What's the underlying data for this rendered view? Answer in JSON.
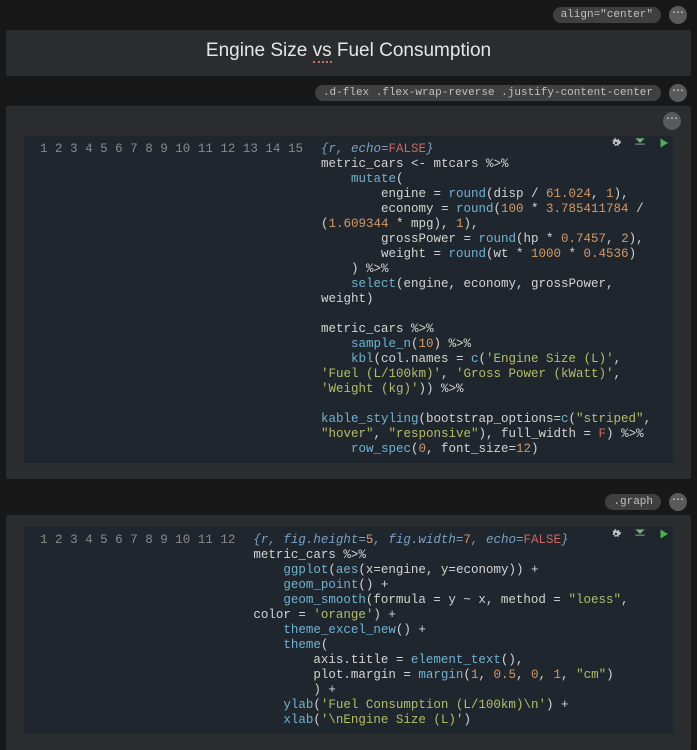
{
  "header": {
    "tag": "align=\"center\"",
    "title_pre": "Engine Size ",
    "title_vs": "vs",
    "title_post": " Fuel Consumption"
  },
  "block1": {
    "tag": ".d-flex .flex-wrap-reverse .justify-content-center",
    "gutter": [
      "1",
      "2",
      "3",
      "4",
      "5",
      "6",
      "7",
      "8",
      "9",
      "10",
      "11",
      "12",
      "13",
      "",
      "14",
      "",
      "15"
    ],
    "lines": {
      "l1_a": "{r, echo=",
      "l1_b": "FALSE",
      "l1_c": "}",
      "l2_a": "metric_cars <- mtcars ",
      "l2_b": "%>%",
      "l3_a": "    ",
      "l3_b": "mutate",
      "l3_c": "(",
      "l4_a": "        engine = ",
      "l4_b": "round",
      "l4_c": "(disp / ",
      "l4_d": "61.024",
      "l4_e": ", ",
      "l4_f": "1",
      "l4_g": "),",
      "l5_a": "        economy = ",
      "l5_b": "round",
      "l5_c": "(",
      "l5_d": "100",
      "l5_e": " * ",
      "l5_f": "3.785411784",
      "l5_g": " / (",
      "l5_h": "1.609344",
      "l5_i": " * mpg), ",
      "l5_j": "1",
      "l5_k": "),",
      "l6_a": "        grossPower = ",
      "l6_b": "round",
      "l6_c": "(hp * ",
      "l6_d": "0.7457",
      "l6_e": ", ",
      "l6_f": "2",
      "l6_g": "),",
      "l7_a": "        weight = ",
      "l7_b": "round",
      "l7_c": "(wt * ",
      "l7_d": "1000",
      "l7_e": " * ",
      "l7_f": "0.4536",
      "l7_g": ")",
      "l8_a": "    ) ",
      "l8_b": "%>%",
      "l9_a": "    ",
      "l9_b": "select",
      "l9_c": "(engine, economy, grossPower, weight)",
      "l10": "",
      "l11_a": "metric_cars ",
      "l11_b": "%>%",
      "l12_a": "    ",
      "l12_b": "sample_n",
      "l12_c": "(",
      "l12_d": "10",
      "l12_e": ") ",
      "l12_f": "%>%",
      "l13_a": "    ",
      "l13_b": "kbl",
      "l13_c": "(col.names = ",
      "l13_d": "c",
      "l13_e": "(",
      "l13_f": "'Engine Size (L)'",
      "l13_g": ", ",
      "l13_h": "'Fuel (L/100km)'",
      "l13_i": ", ",
      "l13_j": "'Gross Power (kWatt)'",
      "l13_k": ", ",
      "l13_l": "'Weight (kg)'",
      "l13_m": ")) ",
      "l13_n": "%>%",
      "l14_a": "    ",
      "l14_b": "kable_styling",
      "l14_c": "(bootstrap_options=",
      "l14_d": "c",
      "l14_e": "(",
      "l14_f": "\"striped\"",
      "l14_g": ", ",
      "l14_h": "\"hover\"",
      "l14_i": ", ",
      "l14_j": "\"responsive\"",
      "l14_k": "), full_width = ",
      "l14_l": "F",
      "l14_m": ") ",
      "l14_n": "%>%",
      "l15_a": "    ",
      "l15_b": "row_spec",
      "l15_c": "(",
      "l15_d": "0",
      "l15_e": ", font_size=",
      "l15_f": "12",
      "l15_g": ")"
    }
  },
  "block2": {
    "tag": ".graph",
    "gutter": [
      "1",
      "2",
      "3",
      "4",
      "5",
      "6",
      "7",
      "8",
      "9",
      "10",
      "11",
      "12"
    ],
    "lines": {
      "l1_a": "{r, fig.height=",
      "l1_b": "5",
      "l1_c": ", fig.width=",
      "l1_d": "7",
      "l1_e": ", echo=",
      "l1_f": "FALSE",
      "l1_g": "}",
      "l2_a": "metric_cars ",
      "l2_b": "%>%",
      "l3_a": "    ",
      "l3_b": "ggplot",
      "l3_c": "(",
      "l3_d": "aes",
      "l3_e": "(x=engine, y=economy)) +",
      "l4_a": "    ",
      "l4_b": "geom_point",
      "l4_c": "() +",
      "l5_a": "    ",
      "l5_b": "geom_smooth",
      "l5_c": "(formula = y ~ x, method = ",
      "l5_d": "\"loess\"",
      "l5_e": ", color = ",
      "l5_f": "'orange'",
      "l5_g": ") +",
      "l6_a": "    ",
      "l6_b": "theme_excel_new",
      "l6_c": "() +",
      "l7_a": "    ",
      "l7_b": "theme",
      "l7_c": "(",
      "l8_a": "        axis.title = ",
      "l8_b": "element_text",
      "l8_c": "(),",
      "l9_a": "        plot.margin = ",
      "l9_b": "margin",
      "l9_c": "(",
      "l9_d": "1",
      "l9_e": ", ",
      "l9_f": "0.5",
      "l9_g": ", ",
      "l9_h": "0",
      "l9_i": ", ",
      "l9_j": "1",
      "l9_k": ", ",
      "l9_l": "\"cm\"",
      "l9_m": ")",
      "l10_a": "        ) +",
      "l11_a": "    ",
      "l11_b": "ylab",
      "l11_c": "(",
      "l11_d": "'Fuel Consumption (L/100km)\\n'",
      "l11_e": ") +",
      "l12_a": "    ",
      "l12_b": "xlab",
      "l12_c": "(",
      "l12_d": "'\\nEngine Size (L)'",
      "l12_e": ")"
    }
  }
}
